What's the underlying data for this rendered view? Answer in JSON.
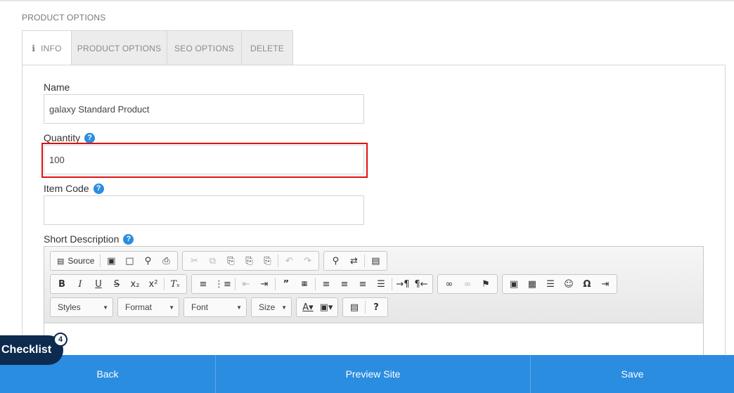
{
  "section_title": "PRODUCT OPTIONS",
  "tabs": [
    {
      "label": "INFO",
      "icon": "info-icon",
      "active": true
    },
    {
      "label": "PRODUCT OPTIONS",
      "active": false
    },
    {
      "label": "SEO OPTIONS",
      "active": false
    },
    {
      "label": "DELETE",
      "active": false
    }
  ],
  "form": {
    "name_label": "Name",
    "name_value": "galaxy Standard Product",
    "quantity_label": "Quantity",
    "quantity_value": "100",
    "item_code_label": "Item Code",
    "item_code_value": "",
    "short_description_label": "Short Description",
    "help_glyph": "?"
  },
  "editor": {
    "source_label": "Source",
    "combos": [
      "Styles",
      "Format",
      "Font",
      "Size"
    ],
    "help_glyph": "?"
  },
  "checklist": {
    "label": "Checklist",
    "count": "4"
  },
  "bottom_bar": {
    "back": "Back",
    "preview": "Preview Site",
    "save": "Save"
  },
  "colors": {
    "accent": "#2a8de0",
    "highlight": "#e01010",
    "checklist_bg": "#0d2a4f"
  }
}
